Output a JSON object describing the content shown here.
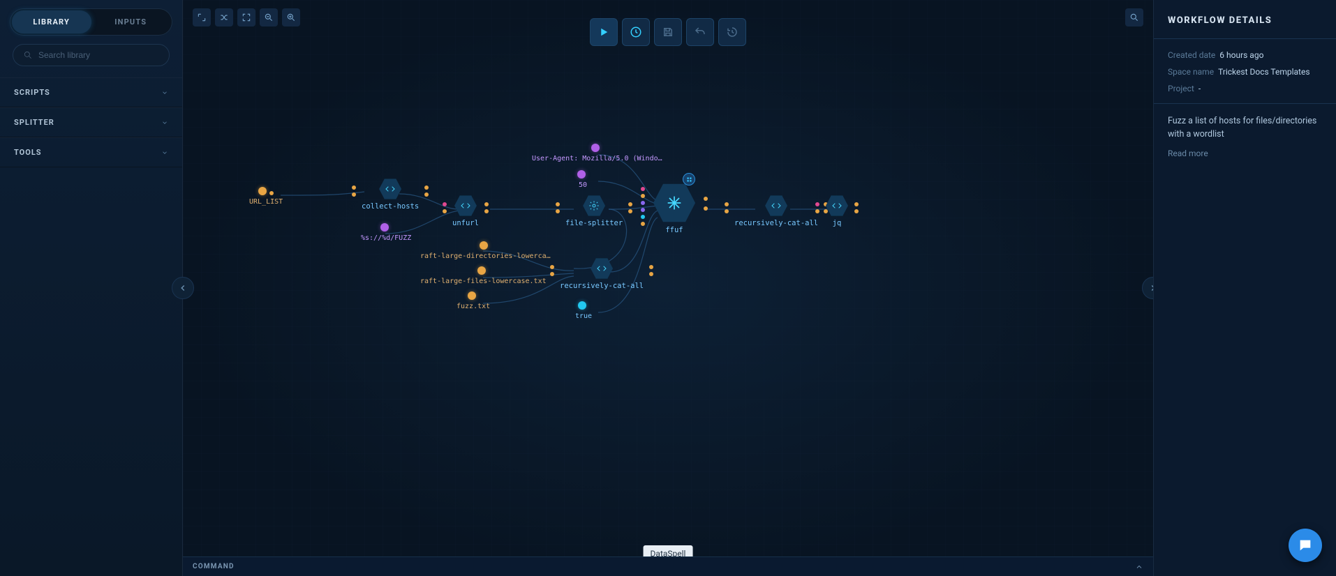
{
  "sidebar": {
    "tabs": {
      "library": "LIBRARY",
      "inputs": "INPUTS",
      "active": "library"
    },
    "search_placeholder": "Search library",
    "sections": [
      "SCRIPTS",
      "SPLITTER",
      "TOOLS"
    ]
  },
  "actionbar": {
    "icons": [
      "play",
      "schedule",
      "save",
      "undo",
      "history"
    ]
  },
  "canvas": {
    "data_chips": {
      "url_list": "URL_LIST",
      "user_agent": "User-Agent: Mozilla/5.0 (Windo…",
      "fifty": "50",
      "fuzz_tpl": "%s://%d/FUZZ",
      "raft_dirs": "raft-large-directories-lowerca…",
      "raft_files": "raft-large-files-lowercase.txt",
      "fuzz_txt": "fuzz.txt",
      "true_val": "true"
    },
    "nodes": {
      "collect_hosts": "collect-hosts",
      "unfurl": "unfurl",
      "file_splitter": "file-splitter",
      "rec_cat_1": "recursively-cat-all",
      "ffuf": "ffuf",
      "rec_cat_2": "recursively-cat-all",
      "jq": "jq"
    }
  },
  "details": {
    "title": "WORKFLOW DETAILS",
    "created_date_label": "Created date",
    "created_date_value": "6 hours ago",
    "space_name_label": "Space name",
    "space_name_value": "Trickest Docs Templates",
    "project_label": "Project",
    "project_value": "-",
    "description": "Fuzz a list of hosts for files/directories with a wordlist",
    "read_more": "Read more"
  },
  "command_bar": {
    "label": "COMMAND"
  },
  "tooltip": "DataSpell"
}
